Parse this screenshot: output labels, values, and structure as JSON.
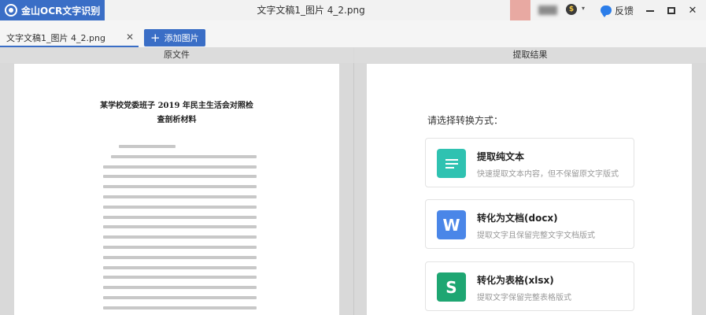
{
  "app": {
    "brand": "金山OCR文字识别",
    "window_title": "文字文稿1_图片 4_2.png"
  },
  "titlebar": {
    "coin_glyph": "$",
    "coin_caret": "▾",
    "feedback_label": "反馈",
    "close_glyph": "✕"
  },
  "tabs": {
    "file_tab_label": "文字文稿1_图片 4_2.png",
    "close_glyph": "✕",
    "add_label": "添加图片",
    "add_glyph": "+"
  },
  "panels": {
    "left_header": "原文件",
    "right_header": "提取结果"
  },
  "document": {
    "title_line1": "某学校党委班子 2019 年民主生活会对照检",
    "title_line2": "查剖析材料"
  },
  "result": {
    "prompt": "请选择转换方式：",
    "options": [
      {
        "title": "提取纯文本",
        "desc": "快速提取文本内容，但不保留原文字版式",
        "icon": "text-lines-icon",
        "color": "#2fc2b1"
      },
      {
        "title": "转化为文档(docx)",
        "desc": "提取文字且保留完整文字文档版式",
        "icon": "word-doc-icon",
        "glyph": "W",
        "color": "#4a86e8"
      },
      {
        "title": "转化为表格(xlsx)",
        "desc": "提取文字保留完整表格版式",
        "icon": "spreadsheet-icon",
        "glyph": "S",
        "color": "#1ea672"
      }
    ]
  },
  "colors": {
    "accent": "#3a6ec6"
  }
}
